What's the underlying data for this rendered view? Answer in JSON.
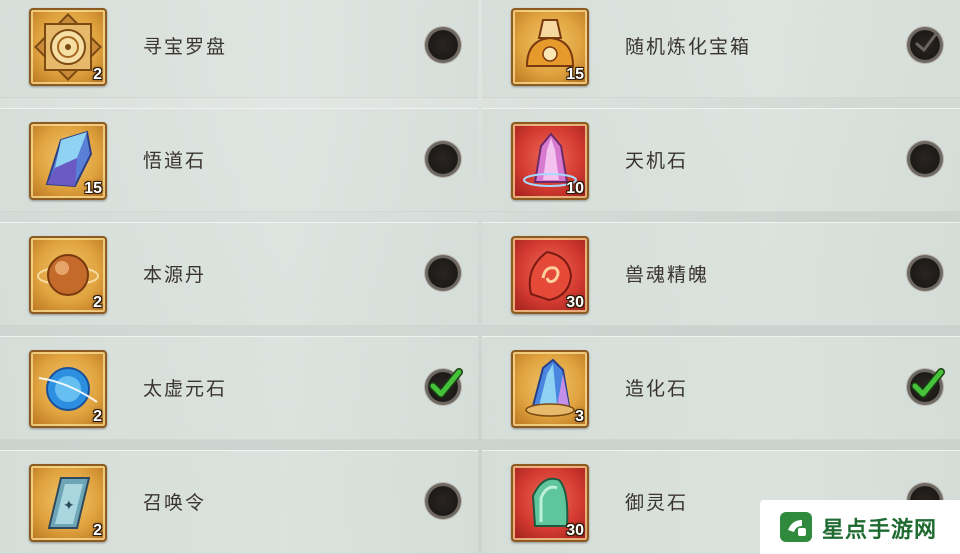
{
  "items_left": [
    {
      "name": "寻宝罗盘",
      "qty": "2",
      "selected": false,
      "icon": "compass-icon",
      "frame": "gold"
    },
    {
      "name": "悟道石",
      "qty": "15",
      "selected": false,
      "icon": "blue-crystal-icon",
      "frame": "gold"
    },
    {
      "name": "本源丹",
      "qty": "2",
      "selected": false,
      "icon": "orb-pill-icon",
      "frame": "gold"
    },
    {
      "name": "太虚元石",
      "qty": "2",
      "selected": true,
      "icon": "blue-sphere-icon",
      "frame": "gold"
    },
    {
      "name": "召唤令",
      "qty": "2",
      "selected": false,
      "icon": "summon-token-icon",
      "frame": "gold"
    }
  ],
  "items_right": [
    {
      "name": "随机炼化宝箱",
      "qty": "15",
      "selected": true,
      "icon": "treasure-bag-icon",
      "frame": "gold"
    },
    {
      "name": "天机石",
      "qty": "10",
      "selected": false,
      "icon": "pink-crystal-icon",
      "frame": "red"
    },
    {
      "name": "兽魂精魄",
      "qty": "30",
      "selected": false,
      "icon": "beast-soul-icon",
      "frame": "red"
    },
    {
      "name": "造化石",
      "qty": "3",
      "selected": true,
      "icon": "rainbow-crystal-icon",
      "frame": "gold"
    },
    {
      "name": "御灵石",
      "qty": "30",
      "selected": false,
      "icon": "jade-stone-icon",
      "frame": "red"
    }
  ],
  "watermark": {
    "text": "星点手游网"
  },
  "colors": {
    "gold_frame": "#e0a33f",
    "red_frame": "#d43b31",
    "check_green": "#45c23a"
  }
}
